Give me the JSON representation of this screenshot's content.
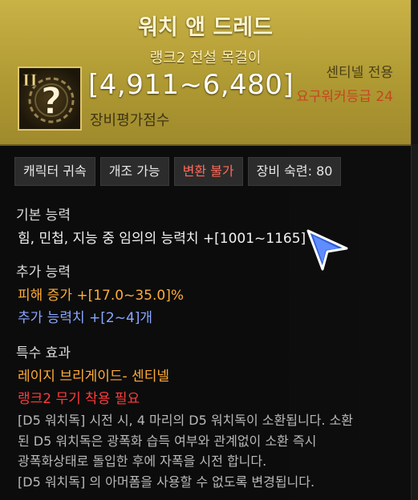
{
  "item": {
    "name": "워치 앤 드레드",
    "rank_type": "랭크2 전설 목걸이",
    "score": "[4,911~6,480]",
    "score_label": "장비평가점수",
    "class_requirement": "센티넬 전용",
    "level_requirement": "요구워커등급 24",
    "tier_badge": "II",
    "icon": "question-mark-icon"
  },
  "tags": [
    "캐릭터 귀속",
    "개조 가능",
    "변환 불가",
    "장비 숙련: 80"
  ],
  "basic_stats": {
    "title": "기본 능력",
    "line": "힘, 민첩, 지능 중 임의의 능력치 +[1001~1165]"
  },
  "extra_stats": {
    "title": "추가 능력",
    "damage_line": "피해 증가  +[17.0~35.0]%",
    "count_line": "추가 능력치 +[2~4]개"
  },
  "special_effect": {
    "title": "특수 효과",
    "skill_line": "레이지 브리게이드- 센티넬",
    "requirement_line": "랭크2 무기 착용 필요",
    "description": [
      "[D5 워치독] 시전 시, 4 마리의 D5 워치독이 소환됩니다. 소환",
      "된 D5 워치독은 광폭화 습득 여부와 관계없이 소환 즉시",
      "광폭화상태로 돌입한 후에 자폭을 시전 합니다.",
      "[D5 워치독] 의 아머폼을 사용할 수 없도록 변경됩니다."
    ]
  },
  "colors": {
    "header_gold": "#b09a33",
    "legend_req": "#c4471d",
    "tag_red": "#ff6a5a",
    "stat_orange": "#ffad3a",
    "stat_blue": "#8aa8ff",
    "warning_red": "#ff3b3b",
    "cursor_blue": "#2f5fd6"
  }
}
